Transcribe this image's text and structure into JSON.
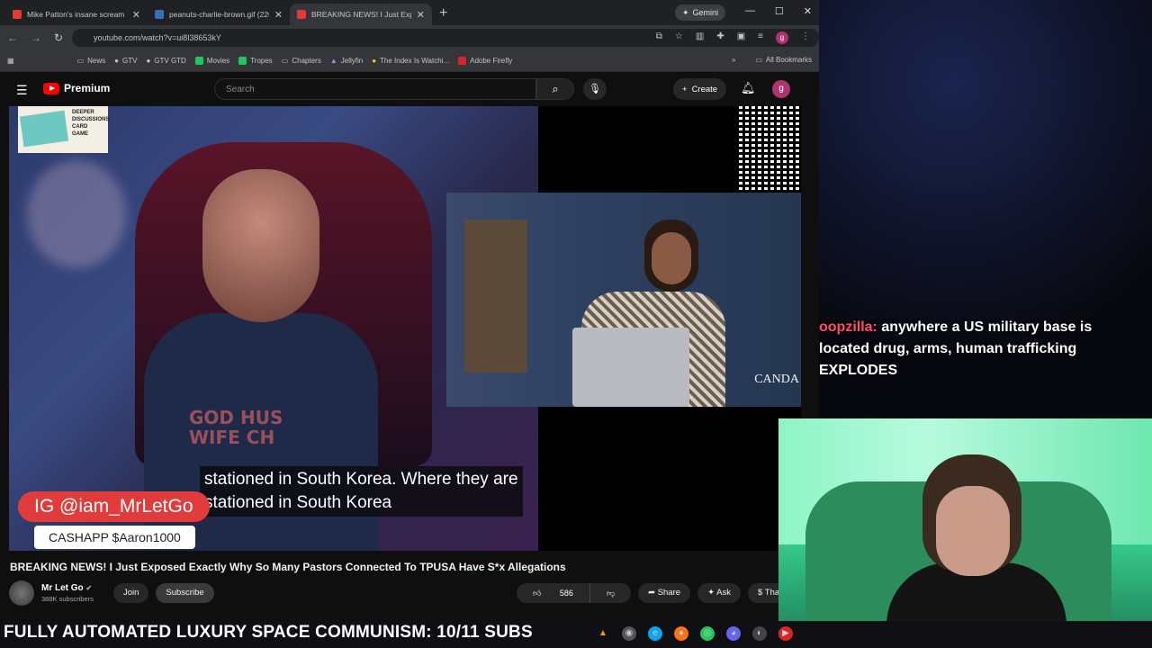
{
  "browser": {
    "tabs": [
      {
        "title": "Mike Patton's insane scream - Y",
        "color": "#e53935"
      },
      {
        "title": "peanuts-charlie-brown.gif (220",
        "color": "#3b6db3"
      },
      {
        "title": "BREAKING NEWS! I Just Expose",
        "color": "#e53935"
      }
    ],
    "gemini_label": "Gemini",
    "url": "youtube.com/watch?v=ui8l38653kY",
    "bookmarks": [
      "News",
      "GTV",
      "GTV GTD",
      "Movies",
      "Tropes",
      "Chapters",
      "Jellyfin",
      "The Index Is Watchi...",
      "Adobe Firefly"
    ],
    "all_bookmarks": "All Bookmarks",
    "profile_initial": "g"
  },
  "youtube": {
    "logo_text": "Premium",
    "search_placeholder": "Search",
    "create_label": "Create",
    "user_initial": "g"
  },
  "video": {
    "caption_line1": "stationed in South Korea. Where they are",
    "caption_line2": "stationed in South Korea",
    "ig_handle": "IG @iam_MrLetGo",
    "cashapp": "CASHAPP $Aaron1000",
    "deeper_text": "DEEPER DISCUSSIONS CARD GAME",
    "shirt_text": "GOD HUS WIFE CH",
    "watermark": "CANDA",
    "title": "BREAKING NEWS! I Just Exposed Exactly Why So Many Pastors Connected To TPUSA Have S*x Allegations",
    "channel_name": "Mr Let Go",
    "subscribers": "388K subscribers",
    "join_label": "Join",
    "subscribe_label": "Subscribe",
    "likes": "586",
    "share_label": "Share",
    "ask_label": "Ask",
    "thanks_label": "Thanks"
  },
  "stream": {
    "chat_user": "oopzilla:",
    "chat_message": "anywhere a US military base is located drug, arms, human trafficking EXPLODES",
    "ticker": "FULLY AUTOMATED LUXURY SPACE COMMUNISM: 10/11 SUBS"
  }
}
